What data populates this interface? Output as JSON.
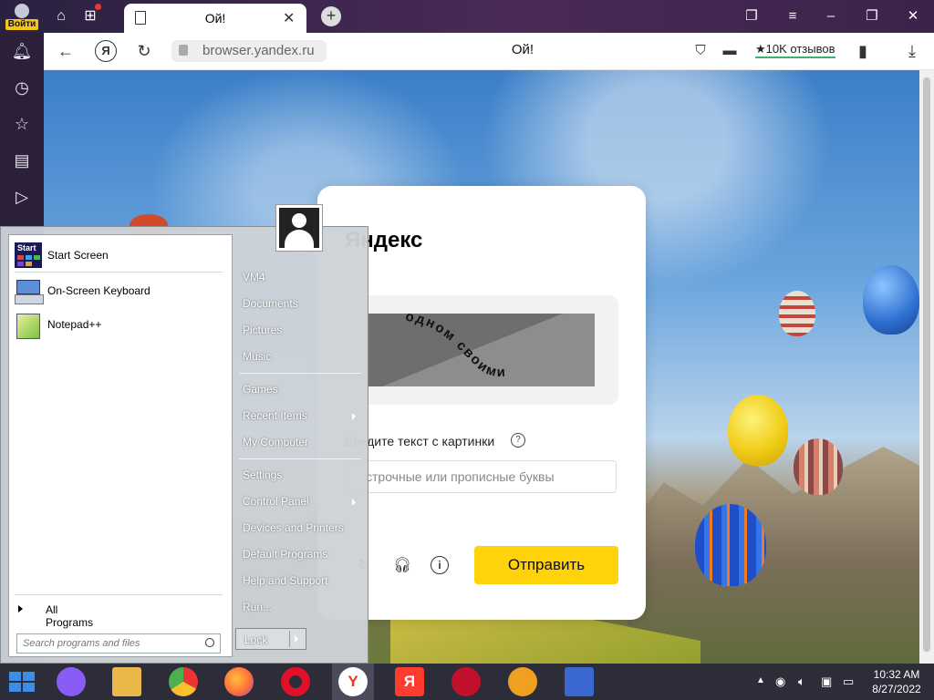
{
  "browser": {
    "login_label": "Войти",
    "tab_title": "Ой!",
    "tab_close": "✕",
    "newtab": "+",
    "page_title": "Ой!",
    "url": "browser.yandex.ru",
    "ya_logo": "Я",
    "reviews": "★10K отзывов",
    "accent": "#ffd20a"
  },
  "captcha": {
    "brand": "Яндекс",
    "label": "Введите текст с картинки",
    "help": "?",
    "placeholder": "строчные или прописные буквы",
    "submit": "Отправить",
    "captcha_word1": "одном",
    "captcha_word2": "своими"
  },
  "startmenu": {
    "programs": [
      {
        "label": "Start Screen",
        "icon": "start-screen-icon",
        "icon_text": "Start"
      },
      {
        "label": "On-Screen Keyboard",
        "icon": "keyboard-icon"
      },
      {
        "label": "Notepad++",
        "icon": "notepadpp-icon"
      }
    ],
    "all_programs": "All Programs",
    "search_placeholder": "Search programs and files",
    "right_links": [
      {
        "label": "VM4"
      },
      {
        "label": "Documents"
      },
      {
        "label": "Pictures"
      },
      {
        "label": "Music"
      },
      {
        "label": "Games"
      },
      {
        "label": "Recent Items",
        "submenu": true
      },
      {
        "label": "My Computer"
      },
      {
        "label": "Settings"
      },
      {
        "label": "Control Panel",
        "submenu": true
      },
      {
        "label": "Devices and Printers"
      },
      {
        "label": "Default Programs"
      },
      {
        "label": "Help and Support"
      },
      {
        "label": "Run..."
      }
    ],
    "lock": "Lock"
  },
  "taskbar": {
    "apps": [
      {
        "name": "alice-icon",
        "color": "#8a5cf6"
      },
      {
        "name": "file-explorer-icon",
        "color": "#e8b84a"
      },
      {
        "name": "chrome-icon",
        "color": "#4caf50"
      },
      {
        "name": "firefox-icon",
        "color": "#ff7139"
      },
      {
        "name": "opera-icon",
        "color": "#e0102b"
      },
      {
        "name": "yandex-browser-icon",
        "color": "#ffffff",
        "text": "Y"
      },
      {
        "name": "yandex-icon",
        "color": "#ff3d2e",
        "text": "Я"
      },
      {
        "name": "app-red-icon",
        "color": "#c0102b"
      },
      {
        "name": "vpn-icon",
        "color": "#f0a020"
      },
      {
        "name": "screenshot-icon",
        "color": "#3a6ad0"
      }
    ],
    "time": "10:32 AM",
    "date": "8/27/2022"
  }
}
